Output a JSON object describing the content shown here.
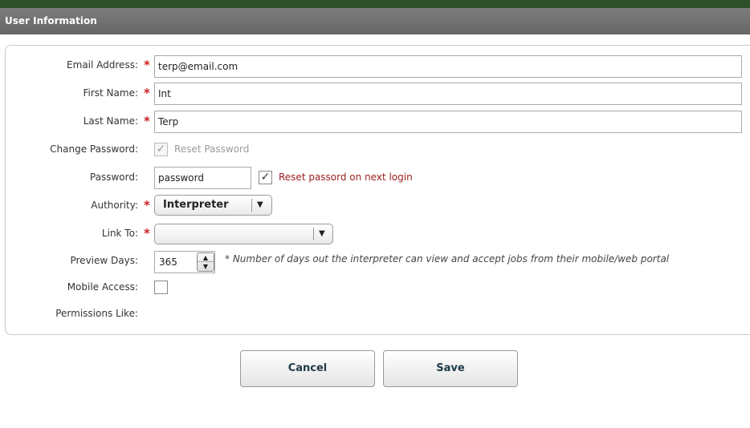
{
  "header": {
    "title": "User Information"
  },
  "form": {
    "email": {
      "label": "Email Address:",
      "value": "terp@email.com"
    },
    "first_name": {
      "label": "First Name:",
      "value": "Int"
    },
    "last_name": {
      "label": "Last Name:",
      "value": "Terp"
    },
    "change_password": {
      "label": "Change Password:",
      "checkbox_label": "Reset Password",
      "checked": true
    },
    "password": {
      "label": "Password:",
      "value": "password",
      "reset_label": "Reset passord on next login",
      "reset_checked": true
    },
    "authority": {
      "label": "Authority:",
      "selected": "Interpreter"
    },
    "link_to": {
      "label": "Link To:",
      "selected": ""
    },
    "preview_days": {
      "label": "Preview Days:",
      "value": "365",
      "note": "* Number of days out the interpreter can view and accept jobs from their mobile/web portal"
    },
    "mobile_access": {
      "label": "Mobile Access:",
      "checked": false
    },
    "permissions_like": {
      "label": "Permissions Like:"
    },
    "required_mark": "*",
    "check_glyph": "✓"
  },
  "buttons": {
    "cancel": "Cancel",
    "save": "Save"
  },
  "colors": {
    "header_bg": "#6f6f6f",
    "topbar": "#2f4f2a",
    "required": "#cc2222",
    "reset_text": "#9b1c1c"
  }
}
